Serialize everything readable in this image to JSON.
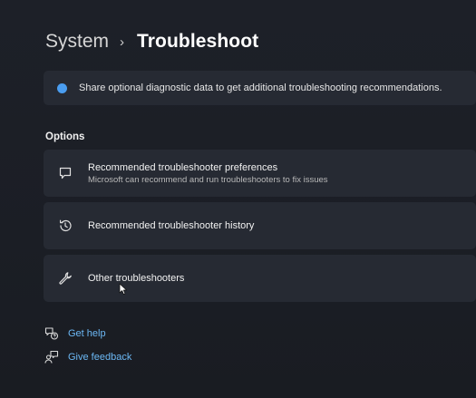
{
  "breadcrumb": {
    "parent": "System",
    "separator": "›",
    "current": "Troubleshoot"
  },
  "banner": {
    "text": "Share optional diagnostic data to get additional troubleshooting recommendations.",
    "icon": "info-icon",
    "accent": "#4a9df0"
  },
  "options": {
    "label": "Options",
    "items": [
      {
        "icon": "chat-bubble-icon",
        "title": "Recommended troubleshooter preferences",
        "subtitle": "Microsoft can recommend and run troubleshooters to fix issues"
      },
      {
        "icon": "history-icon",
        "title": "Recommended troubleshooter history"
      },
      {
        "icon": "wrench-icon",
        "title": "Other troubleshooters"
      }
    ]
  },
  "links": [
    {
      "icon": "help-icon",
      "label": "Get help"
    },
    {
      "icon": "feedback-icon",
      "label": "Give feedback"
    }
  ],
  "colors": {
    "background": "#1c1f26",
    "card": "#262a33",
    "link": "#6cb8f5"
  }
}
